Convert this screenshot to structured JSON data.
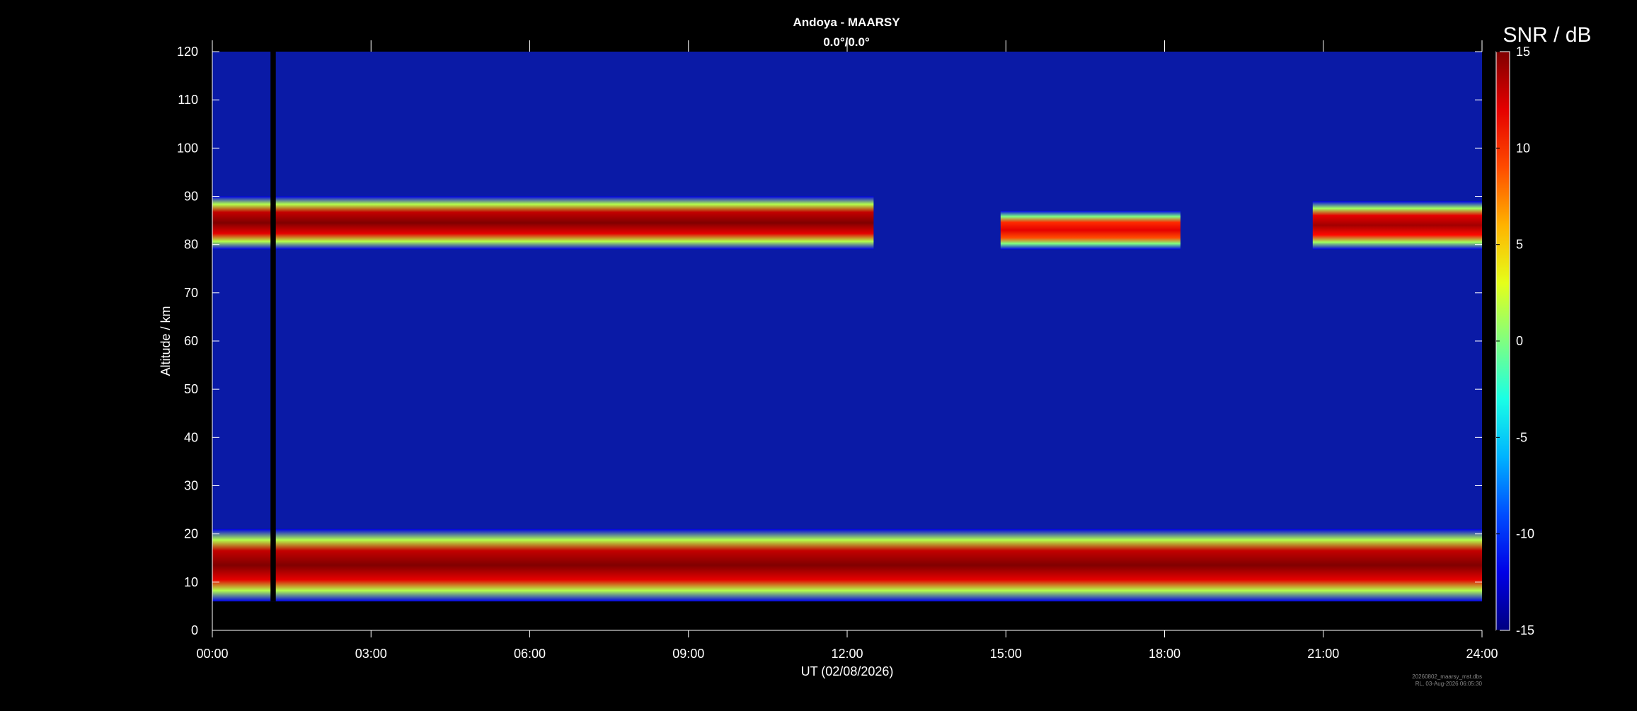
{
  "chart_data": {
    "type": "heatmap",
    "title": "Andoya - MAARSY",
    "subtitle": "0.0°/0.0°",
    "xlabel": "UT (02/08/2026)",
    "ylabel": "Altitude / km",
    "colorbar_label": "SNR / dB",
    "xlim_hours": [
      0,
      24
    ],
    "x_ticks": [
      "00:00",
      "03:00",
      "06:00",
      "09:00",
      "12:00",
      "15:00",
      "18:00",
      "21:00",
      "24:00"
    ],
    "ylim": [
      0,
      120
    ],
    "y_ticks": [
      0,
      10,
      20,
      30,
      40,
      50,
      60,
      70,
      80,
      90,
      100,
      110,
      120
    ],
    "clim": [
      -15,
      15
    ],
    "colorbar_ticks": [
      -15,
      -10,
      -5,
      0,
      5,
      10,
      15
    ],
    "colormap": "jet",
    "background_snr_db": -12,
    "data_gaps": [
      {
        "start_hour": 1.1,
        "end_hour": 1.2
      }
    ],
    "layers": [
      {
        "name": "lower echoes",
        "start_hour": 0,
        "end_hour": 24,
        "bottom_km": 6,
        "top_km": 21,
        "peak_snr_db": 15
      },
      {
        "name": "PMSE",
        "start_hour": 0,
        "end_hour": 12.5,
        "bottom_km": 79,
        "top_km": 90,
        "peak_snr_db": 15
      },
      {
        "name": "PMSE",
        "start_hour": 14.9,
        "end_hour": 18.3,
        "bottom_km": 79,
        "top_km": 87,
        "peak_snr_db": 12
      },
      {
        "name": "PMSE",
        "start_hour": 20.8,
        "end_hour": 24,
        "bottom_km": 79,
        "top_km": 89,
        "peak_snr_db": 14
      }
    ],
    "footer_lines": [
      "20260802_maarsy_mst.dbs",
      "RL, 03-Aug-2026 06:05:30"
    ]
  },
  "colors": {
    "background": "#000000",
    "axes": "#ffffff",
    "text": "#ffffff",
    "plot_background": "#0a1aa6"
  }
}
